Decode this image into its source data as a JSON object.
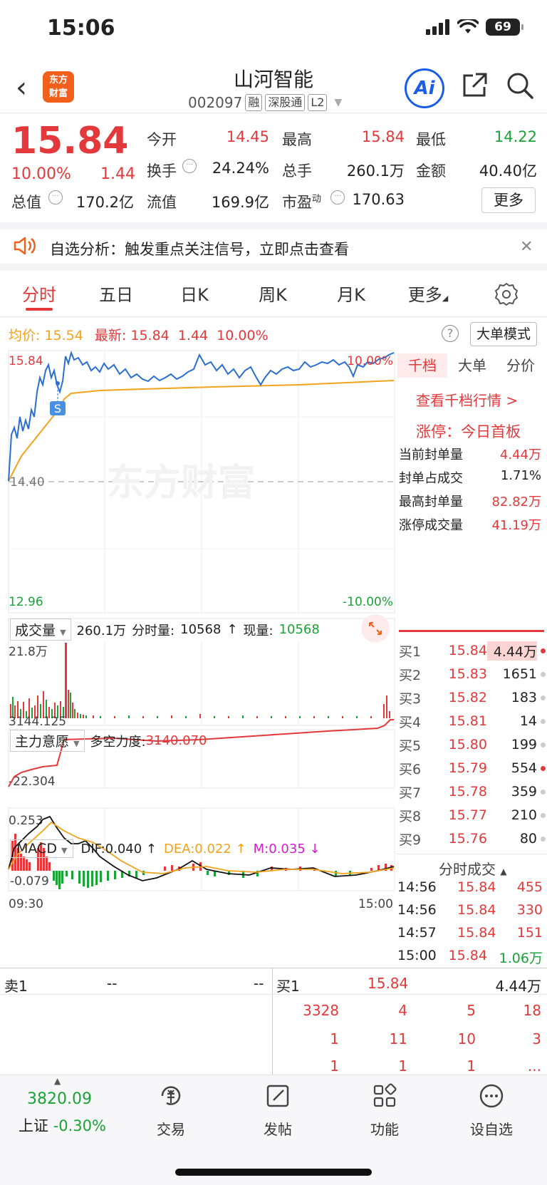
{
  "status": {
    "time": "15:06",
    "battery": "69"
  },
  "header": {
    "name": "山河智能",
    "code": "002097",
    "tags": [
      "融",
      "深股通",
      "L2"
    ],
    "logo": "东方\n财富",
    "ai": "Ai"
  },
  "quote": {
    "price": "15.84",
    "pct": "10.00%",
    "change": "1.44",
    "open_label": "今开",
    "open": "14.45",
    "high_label": "最高",
    "high": "15.84",
    "low_label": "最低",
    "low": "14.22",
    "turnover_label": "换手",
    "turnover": "24.24%",
    "volume_label": "总手",
    "volume": "260.1万",
    "amount_label": "金额",
    "amount": "40.40亿",
    "mktcap_label": "总值",
    "mktcap": "170.2亿",
    "float_label": "流值",
    "float": "169.9亿",
    "pe_label": "市盈",
    "pe_sup": "动",
    "pe": "170.63",
    "more": "更多"
  },
  "notice": {
    "text": "自选分析：触发重点关注信号，立即点击查看"
  },
  "tabs": [
    "分时",
    "五日",
    "日K",
    "周K",
    "月K",
    "更多"
  ],
  "chart_header": {
    "avg_label": "均价:",
    "avg": "15.54",
    "latest_label": "最新:",
    "latest": "15.84",
    "chg": "1.44",
    "pct": "10.00%",
    "big_order": "大单模式"
  },
  "intraday": {
    "y_top": "15.84",
    "y_mid": "14.40",
    "y_bottom": "12.96",
    "pct_top": "10.00%",
    "pct_bottom": "-10.00%",
    "watermark": "东方财富",
    "marker": "S",
    "time_start": "09:30",
    "time_end": "15:00"
  },
  "volume_panel": {
    "selector": "成交量",
    "total": "260.1万",
    "tick_label": "分时量:",
    "tick": "10568",
    "now_label": "现量:",
    "now": "10568",
    "max": "21.8万"
  },
  "intent_panel": {
    "selector": "主力意愿",
    "label": "多空力度:",
    "value": "3140.070",
    "top": "3144.125",
    "bottom": "-22.304"
  },
  "macd_panel": {
    "selector": "MACD",
    "dif": "DIF:0.040 ↑",
    "dea": "DEA:0.022 ↑",
    "m": "M:0.035 ↓",
    "top": "0.253",
    "bottom": "-0.079"
  },
  "right_panel": {
    "tabs": [
      "千档",
      "大单",
      "分价"
    ],
    "link": "查看千档行情 >",
    "limit_title": "涨停：今日首板",
    "stats": [
      {
        "label": "当前封单量",
        "value": "4.44万"
      },
      {
        "label": "封单占成交",
        "value": "1.71%"
      },
      {
        "label": "最高封单量",
        "value": "82.82万"
      },
      {
        "label": "涨停成交量",
        "value": "41.19万"
      }
    ],
    "bids": [
      {
        "label": "买1",
        "price": "15.84",
        "vol": "4.44万",
        "hl": true
      },
      {
        "label": "买2",
        "price": "15.83",
        "vol": "1651",
        "hl": false
      },
      {
        "label": "买3",
        "price": "15.82",
        "vol": "183",
        "hl": false
      },
      {
        "label": "买4",
        "price": "15.81",
        "vol": "14",
        "hl": false
      },
      {
        "label": "买5",
        "price": "15.80",
        "vol": "199",
        "hl": false
      },
      {
        "label": "买6",
        "price": "15.79",
        "vol": "554",
        "hl": true
      },
      {
        "label": "买7",
        "price": "15.78",
        "vol": "359",
        "hl": false
      },
      {
        "label": "买8",
        "price": "15.77",
        "vol": "210",
        "hl": false
      },
      {
        "label": "买9",
        "price": "15.76",
        "vol": "80",
        "hl": false
      }
    ],
    "trades_title": "分时成交",
    "trades": [
      {
        "t": "14:56",
        "p": "15.84",
        "v": "455"
      },
      {
        "t": "14:56",
        "p": "15.84",
        "v": "330"
      },
      {
        "t": "14:57",
        "p": "15.84",
        "v": "151"
      },
      {
        "t": "15:00",
        "p": "15.84",
        "v": "1.06万"
      }
    ]
  },
  "order_book": {
    "sell_label": "卖1",
    "sell_price": "--",
    "sell_vol": "--",
    "buy_label": "买1",
    "buy_price": "15.84",
    "buy_vol": "4.44万",
    "queue": [
      [
        "3328",
        "4",
        "5",
        "18"
      ],
      [
        "1",
        "11",
        "10",
        "3"
      ],
      [
        "1",
        "1",
        "1",
        "..."
      ]
    ]
  },
  "bottom_nav": {
    "index_value": "3820.09",
    "index_name": "上证",
    "index_pct": "-0.30%",
    "items": [
      "交易",
      "发帖",
      "功能",
      "设自选"
    ]
  }
}
